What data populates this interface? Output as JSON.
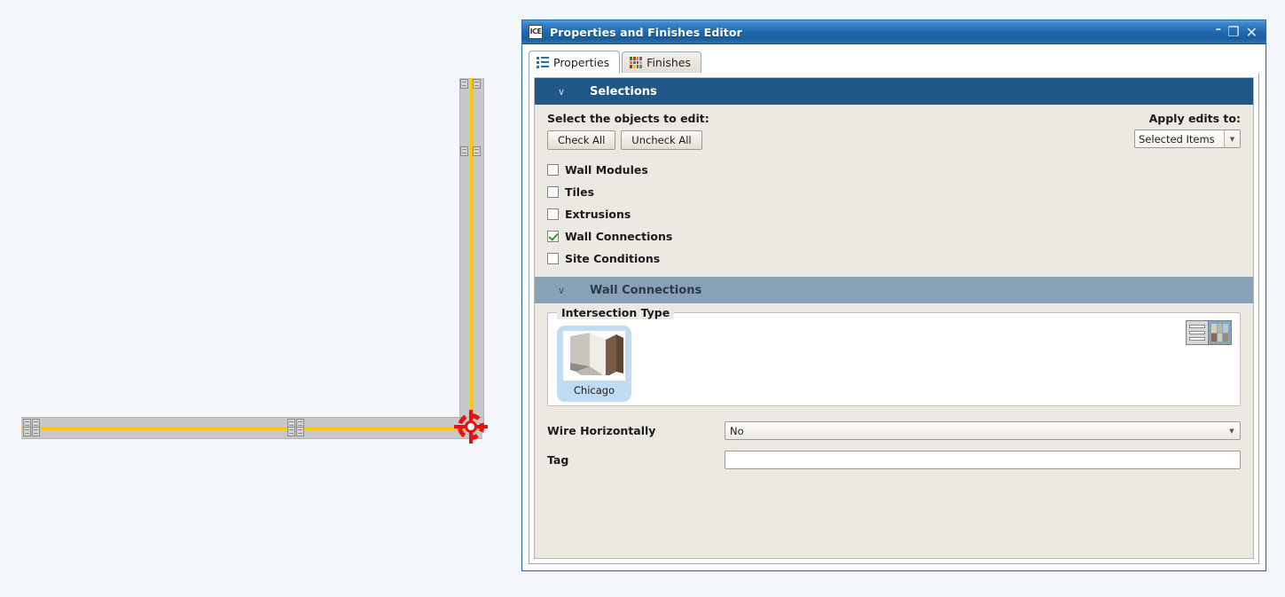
{
  "window": {
    "app_icon_label": "ICE",
    "title": "Properties and Finishes Editor",
    "buttons": {
      "minimize": "–",
      "maximize": "❐",
      "close": "✕"
    }
  },
  "tabs": [
    {
      "label": "Properties",
      "icon": "list-icon",
      "active": true
    },
    {
      "label": "Finishes",
      "icon": "color-grid-icon",
      "active": false
    }
  ],
  "selections": {
    "header": "Selections",
    "chevron": "∨",
    "select_objects_label": "Select the objects to edit:",
    "check_all_label": "Check All",
    "uncheck_all_label": "Uncheck All",
    "apply_edits_label": "Apply edits to:",
    "apply_edits_value": "Selected Items",
    "dropdown_arrow": "▼",
    "items": [
      {
        "label": "Wall Modules",
        "checked": false
      },
      {
        "label": "Tiles",
        "checked": false
      },
      {
        "label": "Extrusions",
        "checked": false
      },
      {
        "label": "Wall Connections",
        "checked": true
      },
      {
        "label": "Site Conditions",
        "checked": false
      }
    ]
  },
  "wall_connections": {
    "header": "Wall Connections",
    "chevron": "∨",
    "intersection_type": {
      "group_label": "Intersection Type",
      "selected": "Chicago",
      "options": [
        "Chicago"
      ],
      "view_toggle": {
        "list_view": "list-view-icon",
        "grid_view": "grid-view-icon",
        "active": "grid_view"
      }
    },
    "fields": [
      {
        "label": "Wire Horizontally",
        "type": "dropdown",
        "value": "No",
        "arrow": "▼"
      },
      {
        "label": "Tag",
        "type": "text",
        "value": "",
        "placeholder": ""
      }
    ]
  },
  "canvas": {
    "walls": [
      {
        "name": "vertical-wall",
        "orientation": "vertical"
      },
      {
        "name": "horizontal-wall",
        "orientation": "horizontal"
      }
    ],
    "junction": {
      "name": "corner-junction",
      "selected": true
    }
  },
  "colors": {
    "titlebar_blue": "#1f68ae",
    "section_primary": "#1f5886",
    "section_secondary": "#87a2b8",
    "panel_bg": "#ece9e3",
    "canvas_bg": "#f4f8fc",
    "wall_fill": "#c8c8c8",
    "wall_centerline": "#ffc800",
    "selection_red": "#e81010",
    "thumb_select_blue": "#bfdcf2",
    "check_green": "#2e9b2e"
  }
}
